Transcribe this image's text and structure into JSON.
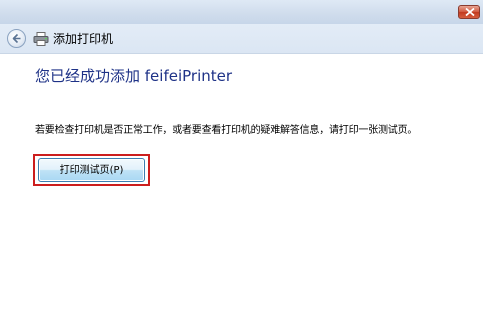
{
  "window": {
    "close_icon": "close-icon"
  },
  "nav": {
    "back_icon": "back-arrow-icon",
    "app_icon": "printer-icon",
    "title": "添加打印机"
  },
  "content": {
    "heading": "您已经成功添加 feifeiPrinter",
    "description": "若要检查打印机是否正常工作，或者要查看打印机的疑难解答信息，请打印一张测试页。",
    "print_test_page_label": "打印测试页(P)"
  },
  "colors": {
    "heading": "#1e3287",
    "highlight_border": "#cc1e1e",
    "close_button": "#c23a1f"
  }
}
